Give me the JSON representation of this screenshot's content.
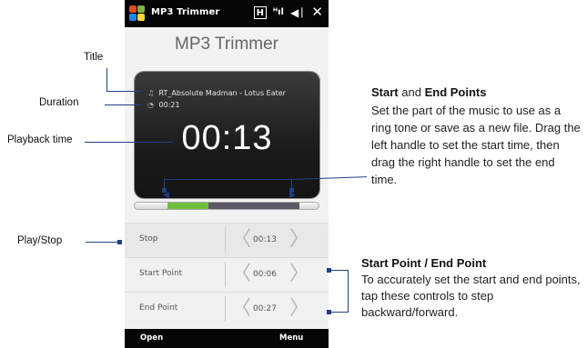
{
  "app": {
    "status_title": "MP3 Trimmer",
    "page_title": "MP3 Trimmer"
  },
  "track": {
    "title": "RT_Absolute Madman - Lotus Eater",
    "duration": "00:21",
    "playback_time": "00:13"
  },
  "slider": {
    "start_fraction": 0.16,
    "played_fraction": 0.38,
    "end_fraction": 0.85,
    "played_color": "#6cbf3a"
  },
  "rows": [
    {
      "label": "Stop",
      "value": "00:13"
    },
    {
      "label": "Start Point",
      "value": "00:06"
    },
    {
      "label": "End Point",
      "value": "00:27"
    }
  ],
  "menu": {
    "left": "Open",
    "right": "Menu"
  },
  "annotations": {
    "title": "Title",
    "duration": "Duration",
    "playback": "Playback time",
    "playstop": "Play/Stop",
    "points_heading_a": "Start",
    "points_heading_and": "and",
    "points_heading_b": "End Points",
    "points_text": "Set the part of the music to use as a ring tone or save as a new file. Drag the left handle to set the start time, then drag the right handle to set the end time.",
    "step_heading": "Start Point / End Point",
    "step_text": "To accurately set the start and end points, tap these controls to step backward/forward."
  },
  "colors": {
    "accent": "#203f86",
    "screen": "#1b1b1b"
  }
}
